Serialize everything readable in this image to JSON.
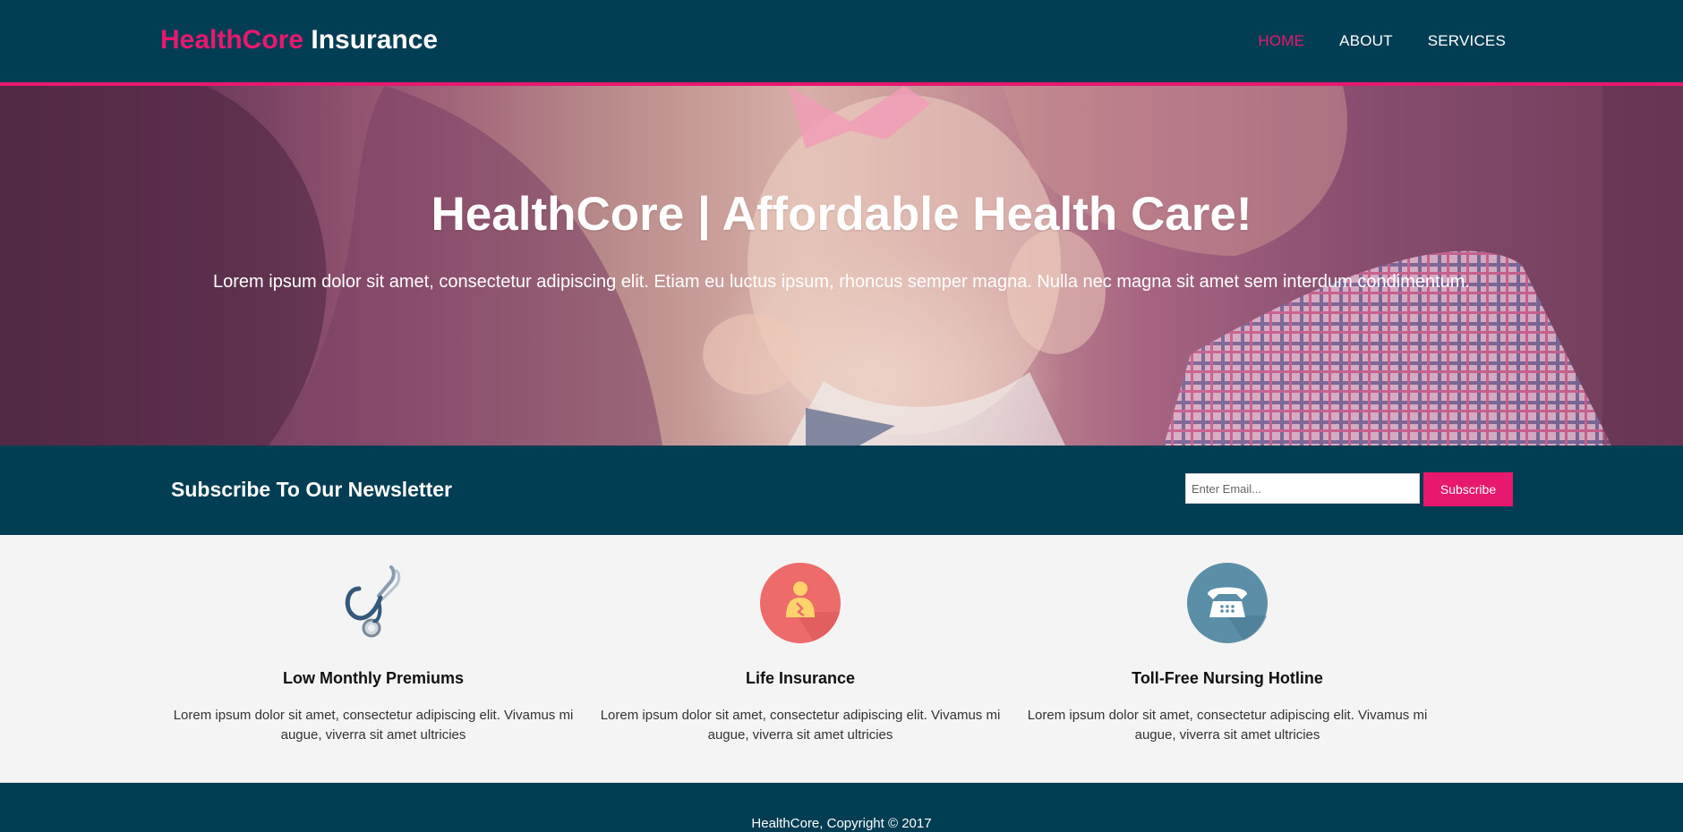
{
  "header": {
    "brand_primary": "HealthCore",
    "brand_secondary": "Insurance",
    "nav": [
      {
        "label": "HOME",
        "active": true
      },
      {
        "label": "ABOUT",
        "active": false
      },
      {
        "label": "SERVICES",
        "active": false
      }
    ]
  },
  "hero": {
    "title": "HealthCore | Affordable Health Care!",
    "text": "Lorem ipsum dolor sit amet, consectetur adipiscing elit. Etiam eu luctus ipsum, rhoncus semper magna. Nulla nec magna sit amet sem interdum condimentum."
  },
  "newsletter": {
    "heading": "Subscribe To Our Newsletter",
    "email_placeholder": "Enter Email...",
    "email_value": "",
    "button_label": "Subscribe"
  },
  "features": [
    {
      "icon": "stethoscope-icon",
      "title": "Low Monthly Premiums",
      "text": "Lorem ipsum dolor sit amet, consectetur adipiscing elit. Vivamus mi augue, viverra sit amet ultricies"
    },
    {
      "icon": "person-icon",
      "title": "Life Insurance",
      "text": "Lorem ipsum dolor sit amet, consectetur adipiscing elit. Vivamus mi augue, viverra sit amet ultricies"
    },
    {
      "icon": "telephone-icon",
      "title": "Toll-Free Nursing Hotline",
      "text": "Lorem ipsum dolor sit amet, consectetur adipiscing elit. Vivamus mi augue, viverra sit amet ultricies"
    }
  ],
  "footer": {
    "copyright": "HealthCore, Copyright © 2017"
  },
  "colors": {
    "primary_dark": "#023e53",
    "accent_pink": "#e8186e",
    "background_light": "#f4f4f4",
    "icon_red": "#ee6b6b",
    "icon_blue": "#5b8fa8"
  }
}
